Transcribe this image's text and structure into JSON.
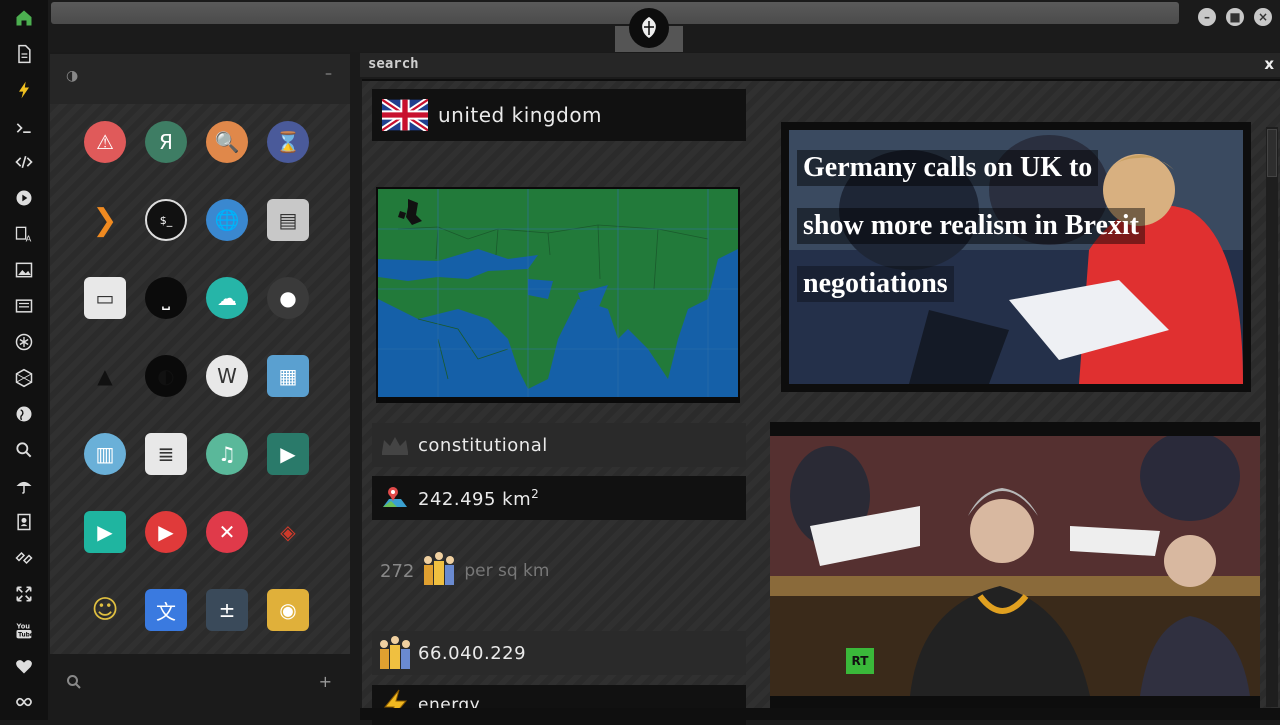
{
  "rail": {
    "icons": [
      "home-icon",
      "document-icon",
      "lightning-icon",
      "terminal-icon",
      "code-icon",
      "play-icon",
      "translate-icon",
      "image-icon",
      "news-icon",
      "asterisk-icon",
      "hexagon-icon",
      "globe-icon",
      "search-icon",
      "umbrella-icon",
      "contacts-icon",
      "link-icon",
      "expand-icon",
      "youtube-icon",
      "heart-icon",
      "infinity-icon"
    ],
    "accent": "#4caf50"
  },
  "topbar": {
    "window_buttons": [
      "–",
      "■",
      "×"
    ]
  },
  "launcher": {
    "contrast_icon": "◑",
    "collapse": "–",
    "add": "+",
    "apps": [
      {
        "icon": "warning-icon",
        "bg": "#e05a5a",
        "glyph": "⚠"
      },
      {
        "icon": "yandex-icon",
        "bg": "#3e7d64",
        "glyph": "Я"
      },
      {
        "icon": "magnifier-app-icon",
        "bg": "#e0884a",
        "glyph": "🔍"
      },
      {
        "icon": "hourglass-icon",
        "bg": "#4a5a9a",
        "glyph": "⌛"
      },
      {
        "icon": "arrow-app-icon",
        "bg": "transparent",
        "glyph": "❯"
      },
      {
        "icon": "terminal-app-icon",
        "bg": "#111",
        "glyph": "$_"
      },
      {
        "icon": "browser-globe-icon",
        "bg": "#3a88d0",
        "glyph": "🌐"
      },
      {
        "icon": "scanner-icon",
        "bg": "#c8c8c8",
        "glyph": "▤"
      },
      {
        "icon": "window-icon",
        "bg": "#e8e8e8",
        "glyph": "▭"
      },
      {
        "icon": "keyboard-app-icon",
        "bg": "#0b0b0b",
        "glyph": "⎵"
      },
      {
        "icon": "cloud-lock-icon",
        "bg": "#26b5a8",
        "glyph": "☁"
      },
      {
        "icon": "github-icon",
        "bg": "#3a3a3a",
        "glyph": "●"
      },
      {
        "icon": "starfleet-icon",
        "bg": "transparent",
        "glyph": "▲"
      },
      {
        "icon": "death-star-icon",
        "bg": "#0a0a0a",
        "glyph": "◐"
      },
      {
        "icon": "wikipedia-icon",
        "bg": "#e8e8e8",
        "glyph": "W"
      },
      {
        "icon": "world-map-icon",
        "bg": "#5aa0d0",
        "glyph": "▦"
      },
      {
        "icon": "books-icon",
        "bg": "#6ab0d8",
        "glyph": "▥"
      },
      {
        "icon": "notes-icon",
        "bg": "#e8e8e8",
        "glyph": "≣"
      },
      {
        "icon": "music-icon",
        "bg": "#5ab89a",
        "glyph": "♫"
      },
      {
        "icon": "video-icon",
        "bg": "#2a7a6a",
        "glyph": "▶"
      },
      {
        "icon": "media-player-icon",
        "bg": "#1fb5a0",
        "glyph": "▶"
      },
      {
        "icon": "youtube-app-icon",
        "bg": "#e03a3a",
        "glyph": "▶"
      },
      {
        "icon": "close-circle-icon",
        "bg": "#e03a4a",
        "glyph": "✕"
      },
      {
        "icon": "ironman-icon",
        "bg": "transparent",
        "glyph": "◈"
      },
      {
        "icon": "c3po-icon",
        "bg": "transparent",
        "glyph": "☺"
      },
      {
        "icon": "translate-app-icon",
        "bg": "#3a7ae0",
        "glyph": "文"
      },
      {
        "icon": "calculator-icon",
        "bg": "#3a4a5a",
        "glyph": "±"
      },
      {
        "icon": "photo-app-icon",
        "bg": "#e0b03a",
        "glyph": "◉"
      }
    ]
  },
  "panel": {
    "title": "search",
    "close": "x",
    "country": "united kingdom",
    "government": "constitutional",
    "area_value": "242.495 km",
    "area_sup": "2",
    "density_value": "272",
    "density_unit": "per sq km",
    "population": "66.040.229",
    "energy": "energy",
    "news": [
      {
        "headline_lines": [
          "Germany calls on UK to",
          "show more realism in Brexit",
          "negotiations"
        ]
      },
      {
        "badge": "RT"
      }
    ]
  }
}
